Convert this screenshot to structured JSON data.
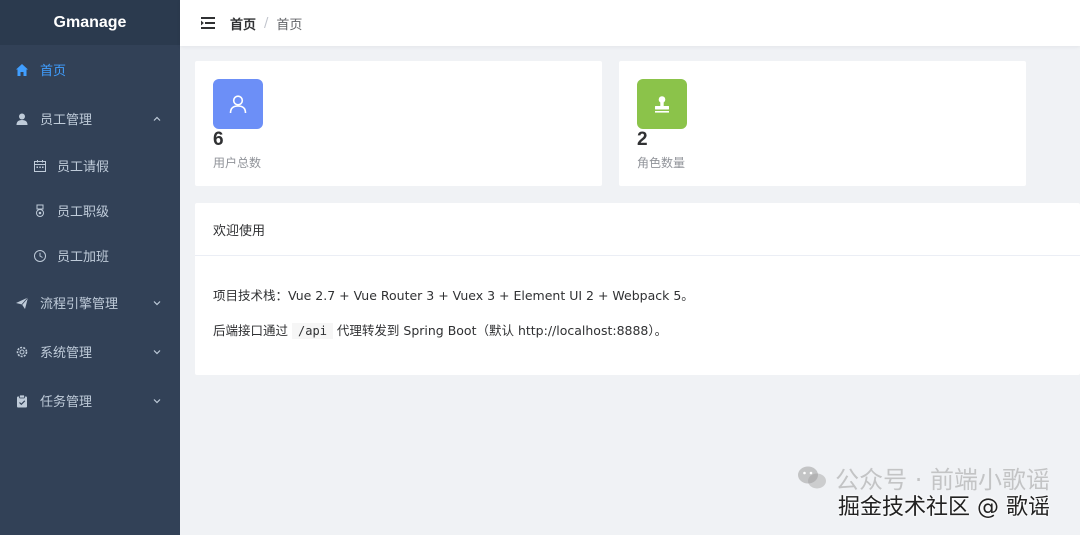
{
  "sidebar": {
    "logo": "Gmanage",
    "items": [
      {
        "label": "首页",
        "icon": "home-icon",
        "active": true
      },
      {
        "label": "员工管理",
        "icon": "user-icon",
        "expanded": true,
        "children": [
          {
            "label": "员工请假",
            "icon": "calendar-icon"
          },
          {
            "label": "员工职级",
            "icon": "medal-icon"
          },
          {
            "label": "员工加班",
            "icon": "clock-icon"
          }
        ]
      },
      {
        "label": "流程引擎管理",
        "icon": "send-icon"
      },
      {
        "label": "系统管理",
        "icon": "gear-icon"
      },
      {
        "label": "任务管理",
        "icon": "clipboard-icon"
      }
    ]
  },
  "header": {
    "breadcrumb": [
      "首页",
      "首页"
    ]
  },
  "stats": [
    {
      "value": "6",
      "label": "用户总数",
      "color": "#6c8ff7",
      "icon": "user-icon"
    },
    {
      "value": "2",
      "label": "角色数量",
      "color": "#8bc34a",
      "icon": "stamp-icon"
    }
  ],
  "welcome": {
    "title": "欢迎使用",
    "line1": "项目技术栈：Vue 2.7 + Vue Router 3 + Vuex 3 + Element UI 2 + Webpack 5。",
    "line2_before": "后端接口通过",
    "line2_code": "/api",
    "line2_after": "代理转发到 Spring Boot（默认 http://localhost:8888）。"
  },
  "watermark": {
    "line1": "公众号 · 前端小歌谣",
    "line2": "掘金技术社区 @ 歌谣"
  },
  "colors": {
    "sidebar_bg": "#324157",
    "active": "#409eff"
  }
}
